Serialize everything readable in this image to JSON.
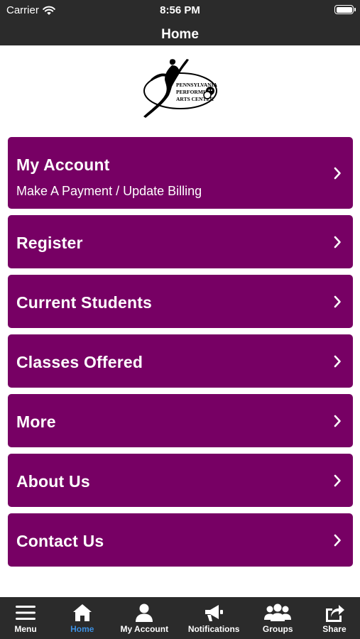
{
  "status_bar": {
    "carrier": "Carrier",
    "time": "8:56 PM"
  },
  "nav": {
    "title": "Home"
  },
  "logo": {
    "text_lines": [
      "PENNSYLVANIA",
      "PERFORMING",
      "ARTS CENTER"
    ]
  },
  "menu_items": [
    {
      "title": "My Account",
      "subtitle": "Make A Payment / Update Billing"
    },
    {
      "title": "Register"
    },
    {
      "title": "Current Students"
    },
    {
      "title": "Classes Offered"
    },
    {
      "title": "More"
    },
    {
      "title": "About Us"
    },
    {
      "title": "Contact Us"
    }
  ],
  "tab_bar": [
    {
      "label": "Menu",
      "icon": "hamburger-icon",
      "active": false
    },
    {
      "label": "Home",
      "icon": "home-icon",
      "active": true
    },
    {
      "label": "My Account",
      "icon": "person-icon",
      "active": false
    },
    {
      "label": "Notifications",
      "icon": "megaphone-icon",
      "active": false
    },
    {
      "label": "Groups",
      "icon": "group-icon",
      "active": false
    },
    {
      "label": "Share",
      "icon": "share-icon",
      "active": false
    }
  ],
  "colors": {
    "button_bg": "#770064",
    "bar_bg": "#2b2b2b",
    "active_tab": "#3d8fe0"
  }
}
